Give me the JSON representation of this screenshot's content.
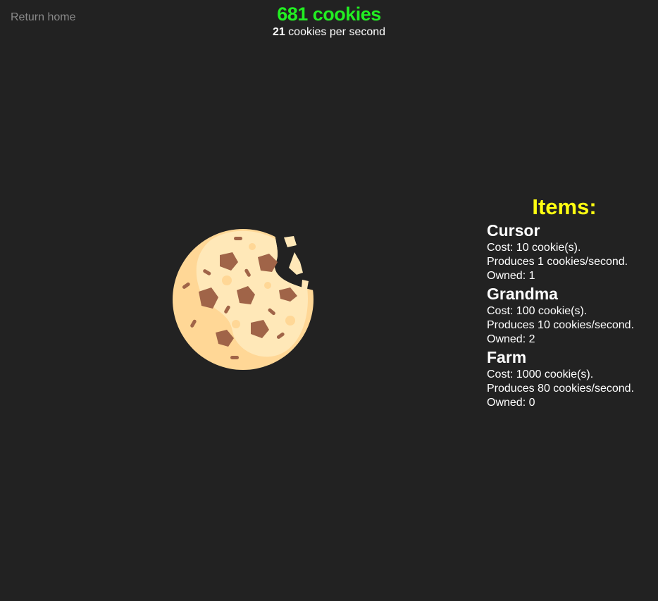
{
  "nav": {
    "return_home": "Return home"
  },
  "header": {
    "cookie_count": "681 cookies",
    "cps_value": "21",
    "cps_suffix": " cookies per second"
  },
  "cookie": {
    "icon": "cookie-icon"
  },
  "shop": {
    "title": "Items:",
    "items": [
      {
        "name": "Cursor",
        "cost": "Cost: 10 cookie(s).",
        "produces": "Produces 1 cookies/second.",
        "owned": "Owned: 1"
      },
      {
        "name": "Grandma",
        "cost": "Cost: 100 cookie(s).",
        "produces": "Produces 10 cookies/second.",
        "owned": "Owned: 2"
      },
      {
        "name": "Farm",
        "cost": "Cost: 1000 cookie(s).",
        "produces": "Produces 80 cookies/second.",
        "owned": "Owned: 0"
      }
    ]
  },
  "colors": {
    "background": "#222222",
    "count_green": "#22ee22",
    "items_yellow": "#ffff11",
    "link_gray": "#8a8a8a"
  }
}
